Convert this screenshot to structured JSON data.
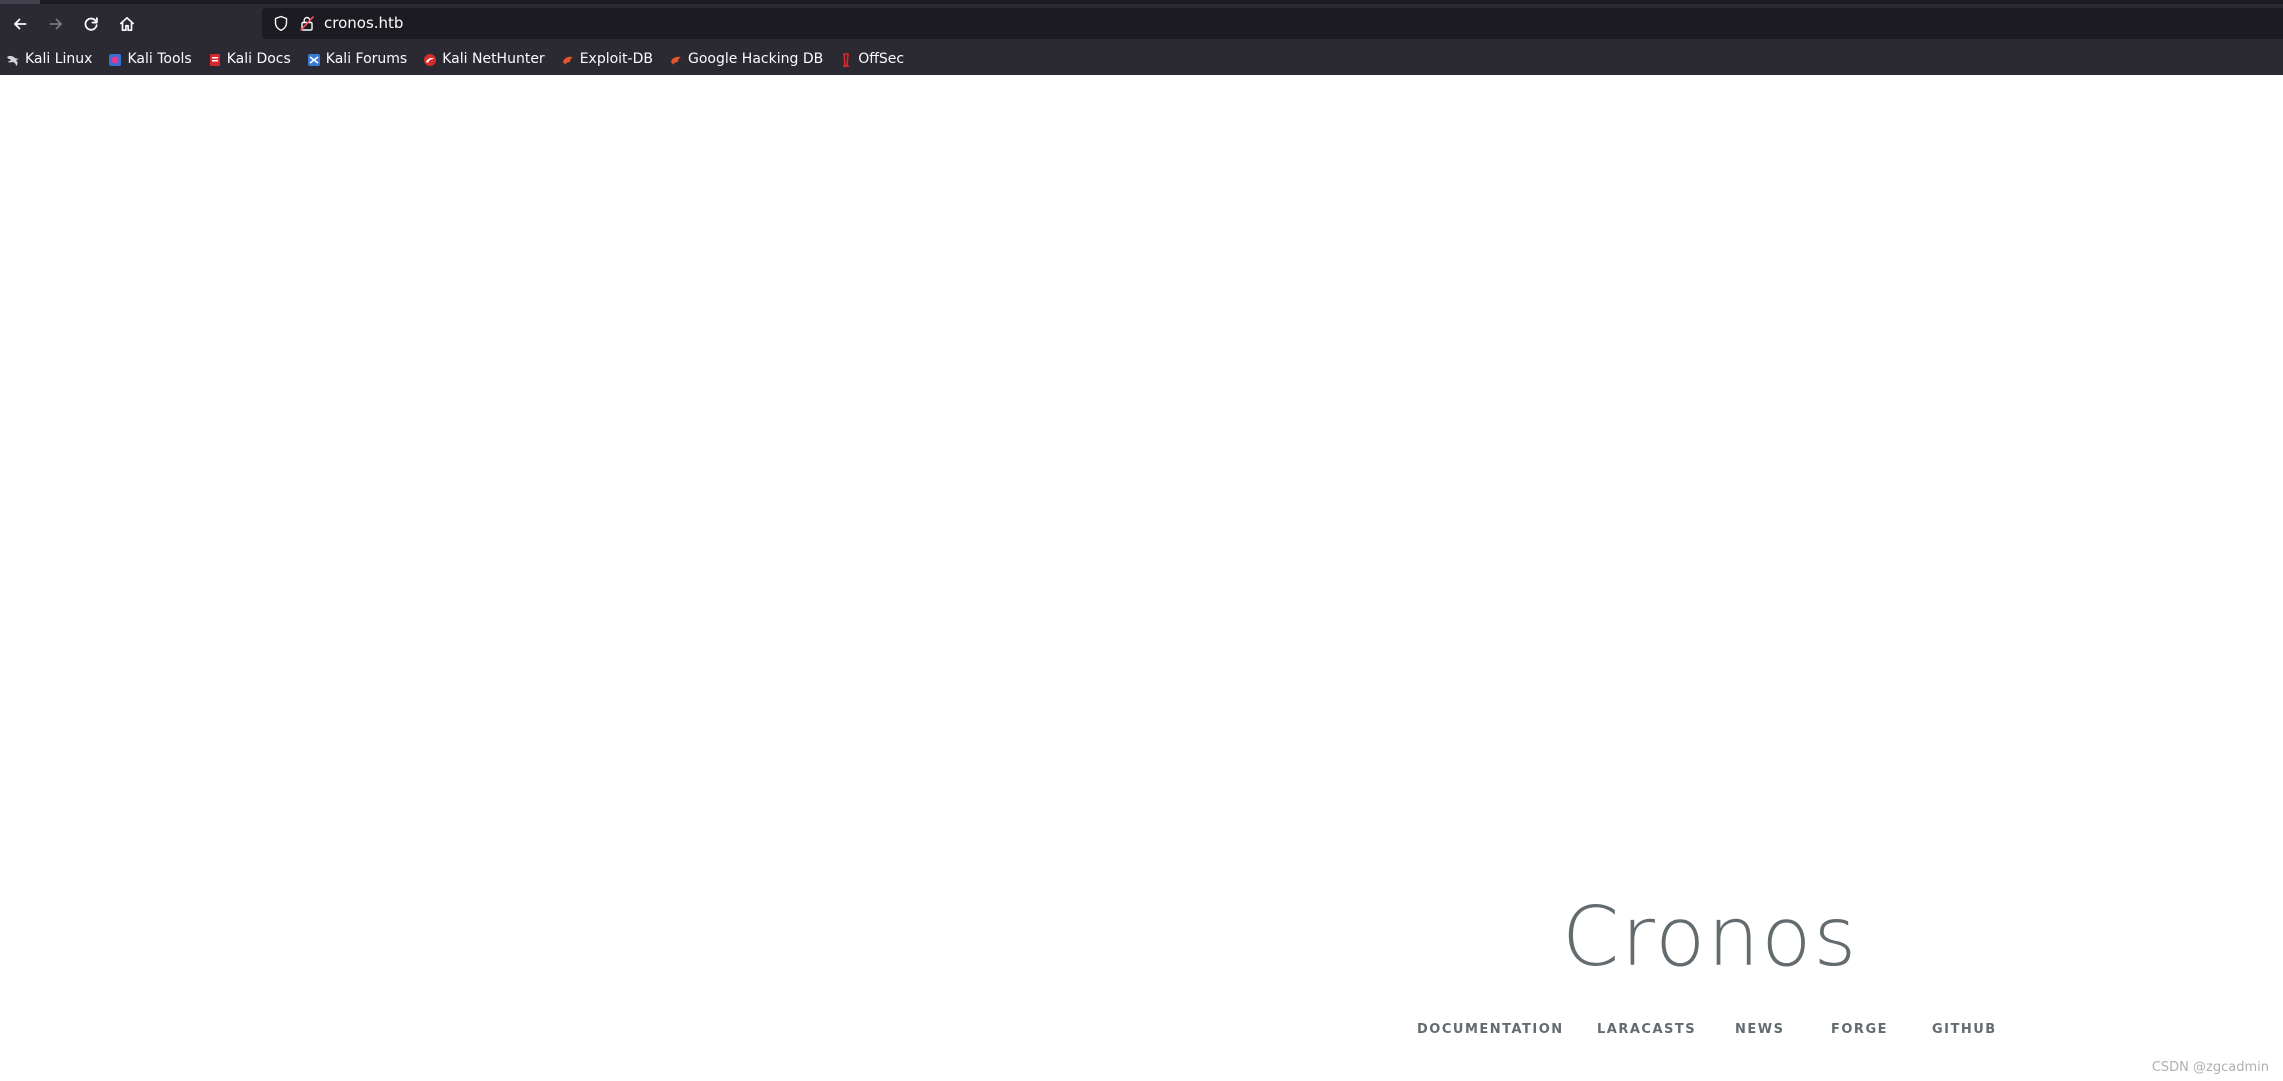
{
  "browser": {
    "url": "cronos.htb",
    "nav_icons": {
      "back": "arrow-left-icon",
      "forward": "arrow-right-icon",
      "reload": "reload-icon",
      "home": "home-icon"
    },
    "bookmarks": [
      {
        "label": "Kali Linux",
        "icon": "kali-dragon-icon",
        "color": "#3a3a3a"
      },
      {
        "label": "Kali Tools",
        "icon": "kali-tools-icon",
        "color": "#e03b8b"
      },
      {
        "label": "Kali Docs",
        "icon": "kali-docs-icon",
        "color": "#d9262b"
      },
      {
        "label": "Kali Forums",
        "icon": "kali-forums-icon",
        "color": "#3a7bd5"
      },
      {
        "label": "Kali NetHunter",
        "icon": "nethunter-icon",
        "color": "#d42d2d"
      },
      {
        "label": "Exploit-DB",
        "icon": "exploit-db-icon",
        "color": "#e8552b"
      },
      {
        "label": "Google Hacking DB",
        "icon": "ghdb-icon",
        "color": "#e8552b"
      },
      {
        "label": "OffSec",
        "icon": "offsec-icon",
        "color": "#e0262b"
      }
    ]
  },
  "page": {
    "title": "Cronos",
    "links": [
      "DOCUMENTATION",
      "LARACASTS",
      "NEWS",
      "FORGE",
      "GITHUB"
    ],
    "watermark": "CSDN @zgcadmin"
  }
}
